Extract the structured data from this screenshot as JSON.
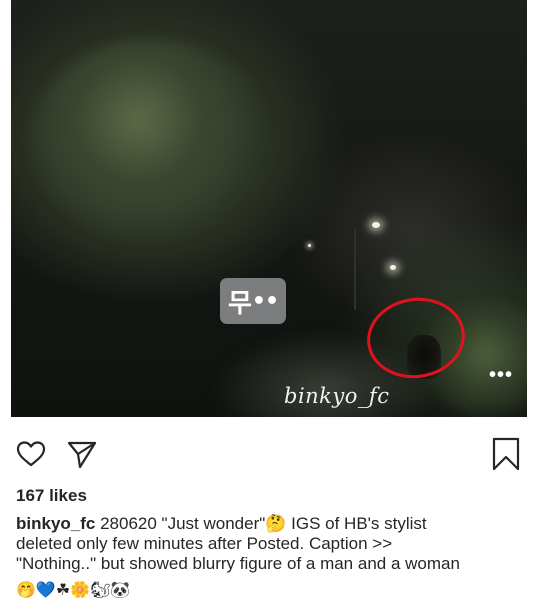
{
  "post": {
    "watermark": "binkyo_fc",
    "sticker_char": "무",
    "sticker_dots": "••",
    "more_menu": "•••"
  },
  "actions": {
    "like_icon": "heart-outline-icon",
    "share_icon": "paper-plane-icon",
    "save_icon": "bookmark-outline-icon"
  },
  "likes": {
    "text": "167 likes"
  },
  "caption": {
    "username": "binkyo_fc",
    "line1": " 280620 \"Just wonder\"🤔 IGS of HB's stylist",
    "line2": "deleted only few minutes after Posted. Caption >>",
    "line3": "\"Nothing..\" but showed blurry figure of a man and a woman",
    "emojis": "🤭💙☘🌼🐿🐼"
  },
  "colors": {
    "highlight_circle": "#e0131c",
    "sticker_bg": "#7c7d7f",
    "text": "#262626"
  }
}
